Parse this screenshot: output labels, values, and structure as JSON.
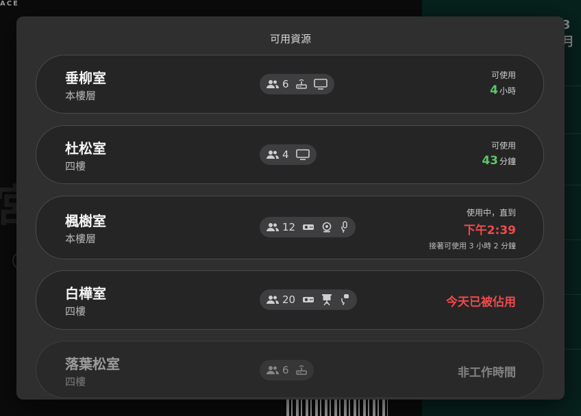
{
  "background": {
    "top_left_text": "ACE",
    "month_text": "3月",
    "big_text": "宮"
  },
  "modal": {
    "title": "可用資源",
    "rooms": [
      {
        "name": "垂柳室",
        "floor": "本樓層",
        "capacity": "6",
        "amenities": [
          "router-icon",
          "monitor-icon"
        ],
        "status": {
          "label": "可使用",
          "value": "4",
          "unit": "小時",
          "color": "#5cc56a"
        }
      },
      {
        "name": "杜松室",
        "floor": "四樓",
        "capacity": "4",
        "amenities": [
          "monitor-icon"
        ],
        "status": {
          "label": "可使用",
          "value": "43",
          "unit": "分鐘",
          "color": "#5cc56a"
        }
      },
      {
        "name": "楓樹室",
        "floor": "本樓層",
        "capacity": "12",
        "amenities": [
          "projector-icon",
          "webcam-icon",
          "microphone-icon"
        ],
        "status": {
          "label": "使用中，直到",
          "value": "下午2:39",
          "next": "接著可使用 3 小時 2 分鐘",
          "color": "#f04a4a"
        }
      },
      {
        "name": "白樺室",
        "floor": "四樓",
        "capacity": "20",
        "amenities": [
          "projector-icon",
          "presentation-screen-icon",
          "microphone-icon"
        ],
        "status": {
          "value": "今天已被佔用",
          "color": "#f04a4a"
        }
      },
      {
        "name": "落葉松室",
        "floor": "四樓",
        "capacity": "6",
        "amenities": [
          "router-icon"
        ],
        "status": {
          "value": "非工作時間"
        }
      }
    ]
  }
}
